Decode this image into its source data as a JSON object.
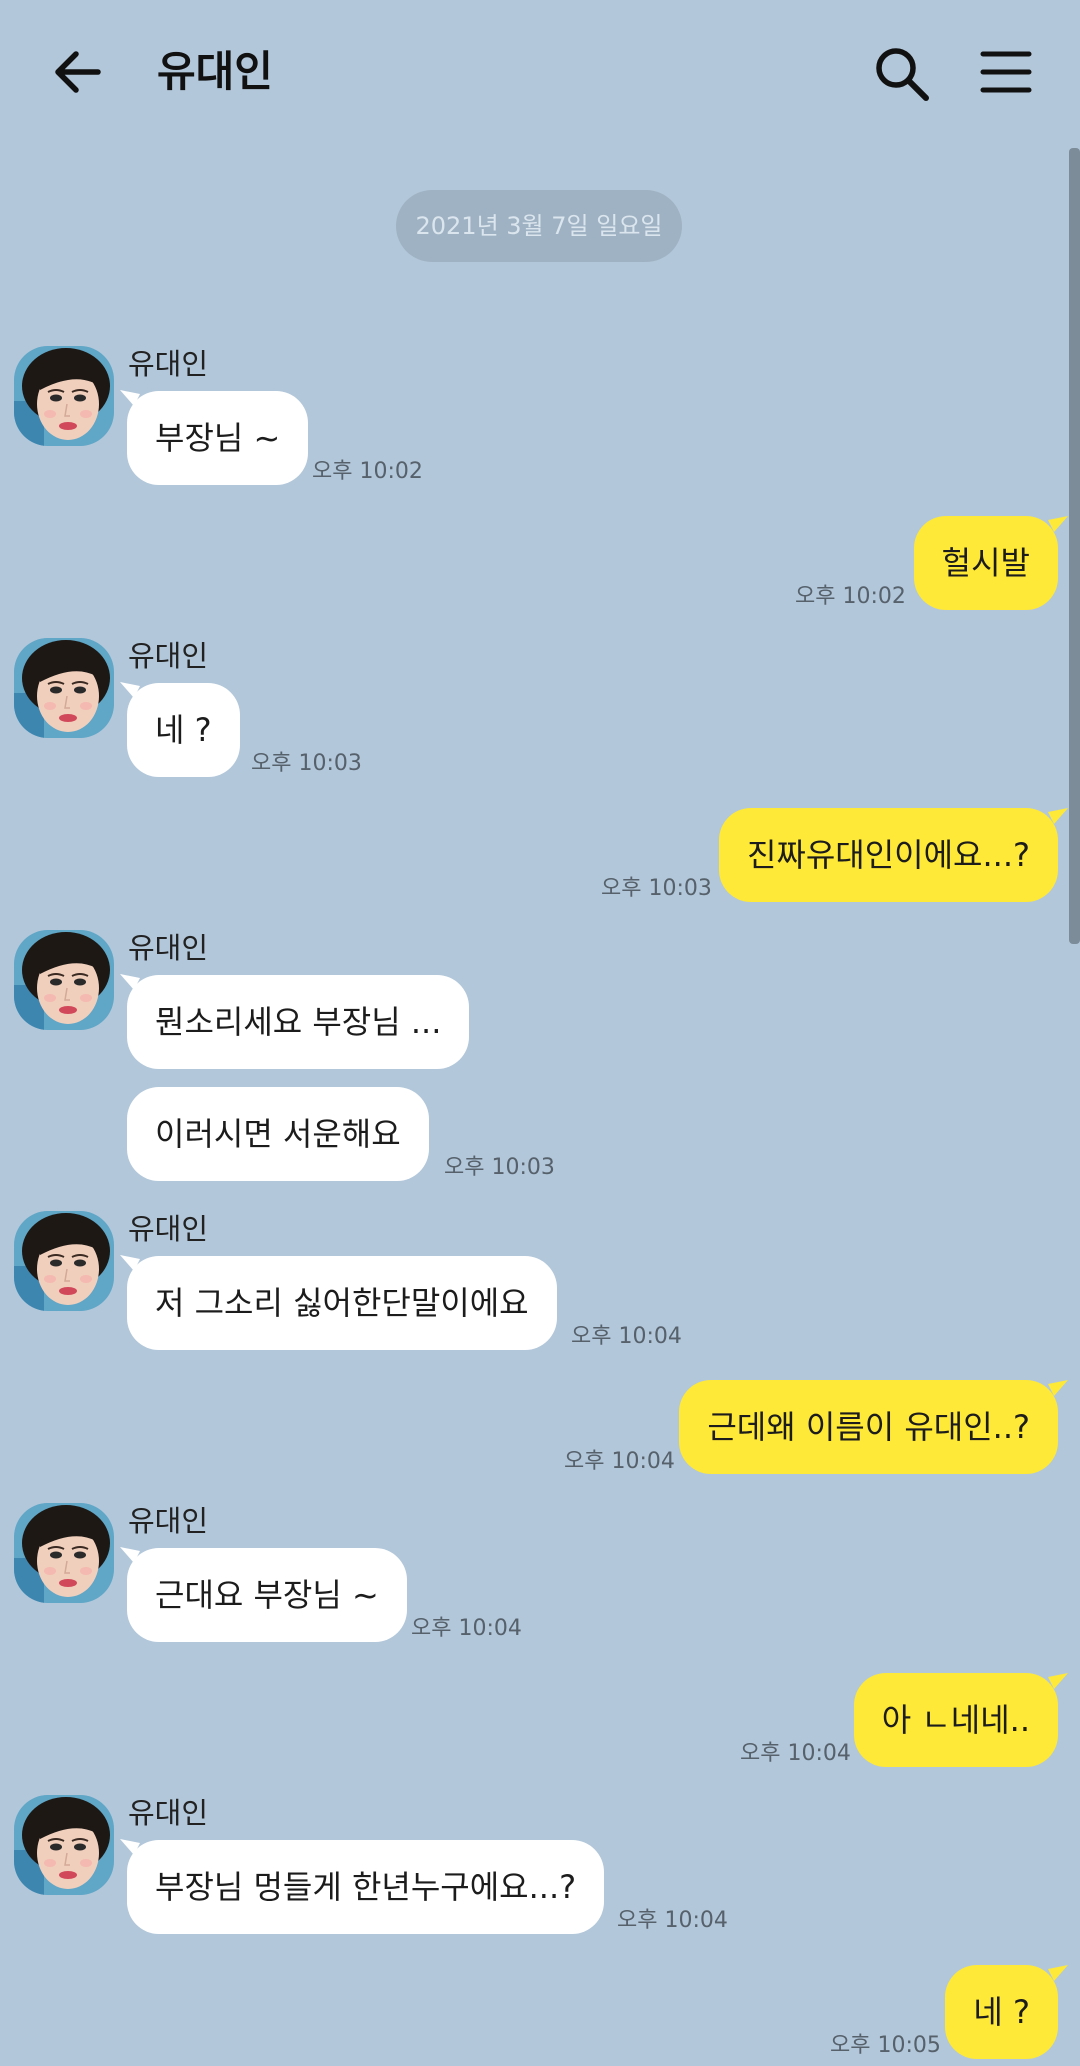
{
  "header": {
    "title": "유대인",
    "back_icon": "arrow-left-icon",
    "search_icon": "search-icon",
    "menu_icon": "hamburger-menu-icon"
  },
  "colors": {
    "background": "#b2c7da",
    "incoming_bubble": "#ffffff",
    "outgoing_bubble": "#fee838",
    "date_pill": "#9fb2c3"
  },
  "date_divider": "2021년 3월 7일 일요일",
  "messages": [
    {
      "dir": "in",
      "sender": "유대인",
      "text": "부장님 ~",
      "time": "오후 10:02"
    },
    {
      "dir": "out",
      "text": "헐시발",
      "time": "오후 10:02"
    },
    {
      "dir": "in",
      "sender": "유대인",
      "text": "네 ?",
      "time": "오후 10:03"
    },
    {
      "dir": "out",
      "text": "진짜유대인이에요...?",
      "time": "오후 10:03"
    },
    {
      "dir": "in",
      "sender": "유대인",
      "text": "뭔소리세요 부장님 ..."
    },
    {
      "dir": "in",
      "text": "이러시면 서운해요",
      "time": "오후 10:03"
    },
    {
      "dir": "in",
      "sender": "유대인",
      "text": "저 그소리 싫어한단말이에요",
      "time": "오후 10:04"
    },
    {
      "dir": "out",
      "text": "근데왜 이름이 유대인..?",
      "time": "오후 10:04"
    },
    {
      "dir": "in",
      "sender": "유대인",
      "text": "근대요 부장님 ~",
      "time": "오후 10:04"
    },
    {
      "dir": "out",
      "text": "아 ㄴ네네..",
      "time": "오후 10:04"
    },
    {
      "dir": "in",
      "sender": "유대인",
      "text": "부장님 멍들게 한년누구에요...?",
      "time": "오후 10:04"
    },
    {
      "dir": "out",
      "text": "네 ?",
      "time": "오후 10:05"
    }
  ]
}
